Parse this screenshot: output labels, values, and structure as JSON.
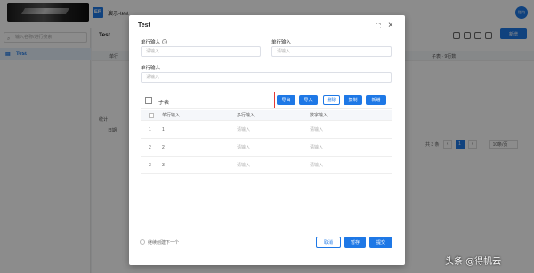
{
  "header": {
    "app_icon_text": "ER",
    "app_title": "演示-test",
    "avatar_text": "账内"
  },
  "sidebar": {
    "search_placeholder": "输入名称/进行搜索",
    "items": [
      {
        "label": "Test"
      }
    ]
  },
  "main": {
    "title": "Test",
    "new_button": "新增",
    "columns": [
      "单行",
      "子表 · 9行数"
    ],
    "sum_label": "统计",
    "total_label": "日期",
    "pagination": {
      "total": "共 3 条",
      "current": "1",
      "page_size": "10条/页"
    }
  },
  "modal": {
    "title": "Test",
    "fields": [
      {
        "label": "单行输入",
        "placeholder": "请输入",
        "help": "?"
      },
      {
        "label": "单行输入",
        "placeholder": "请输入"
      },
      {
        "label": "单行输入",
        "placeholder": "请输入"
      }
    ],
    "subtable": {
      "label": "子表",
      "buttons": {
        "export": "导出",
        "import": "导入",
        "delete": "删除",
        "copy": "复制",
        "add": "新增"
      },
      "columns": [
        "单行输入",
        "多行输入",
        "数字输入"
      ],
      "rows": [
        {
          "index": "1",
          "col1": "1",
          "col2": "请输入",
          "col3": "请输入"
        },
        {
          "index": "2",
          "col1": "2",
          "col2": "请输入",
          "col3": "请输入"
        },
        {
          "index": "3",
          "col1": "3",
          "col2": "请输入",
          "col3": "请输入"
        }
      ]
    },
    "footer": {
      "continue_label": "继续创建下一个",
      "cancel": "取消",
      "temp_save": "暂存",
      "submit": "提交"
    }
  },
  "watermark": "头条 @得帆云",
  "colors": {
    "primary": "#1e78e6",
    "highlight": "#e53935"
  }
}
